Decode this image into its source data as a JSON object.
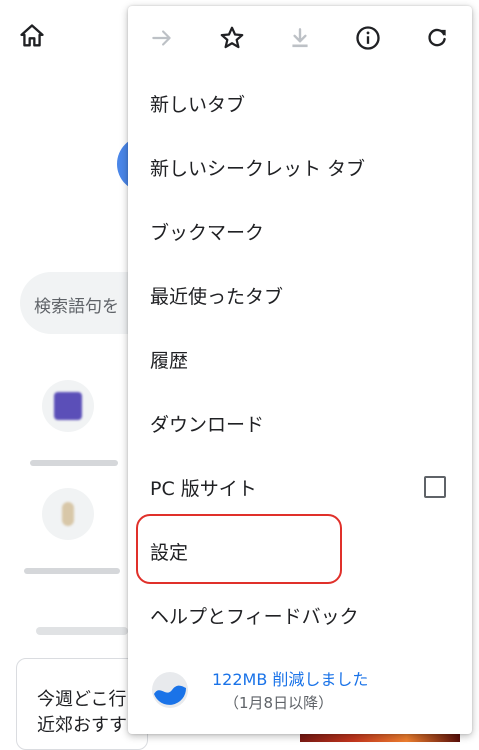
{
  "background": {
    "search_placeholder": "検索語句を",
    "card_line1": "今週どこ行",
    "card_line2": "近郊おすす"
  },
  "toolbar": {
    "icons": [
      "forward-icon",
      "star-icon",
      "download-icon",
      "info-icon",
      "refresh-icon"
    ]
  },
  "menu": {
    "items": [
      {
        "label": "新しいタブ"
      },
      {
        "label": "新しいシークレット タブ"
      },
      {
        "label": "ブックマーク"
      },
      {
        "label": "最近使ったタブ"
      },
      {
        "label": "履歴"
      },
      {
        "label": "ダウンロード"
      },
      {
        "label": "PC 版サイト",
        "checked": false
      },
      {
        "label": "設定"
      },
      {
        "label": "ヘルプとフィードバック"
      }
    ]
  },
  "savings": {
    "title": "122MB 削減しました",
    "subtitle": "（1月8日以降）"
  },
  "colors": {
    "accent": "#1a73e8",
    "highlight": "#e0302a",
    "text": "#202124",
    "icon": "#202124",
    "disabled_icon": "#bdc1c6"
  }
}
